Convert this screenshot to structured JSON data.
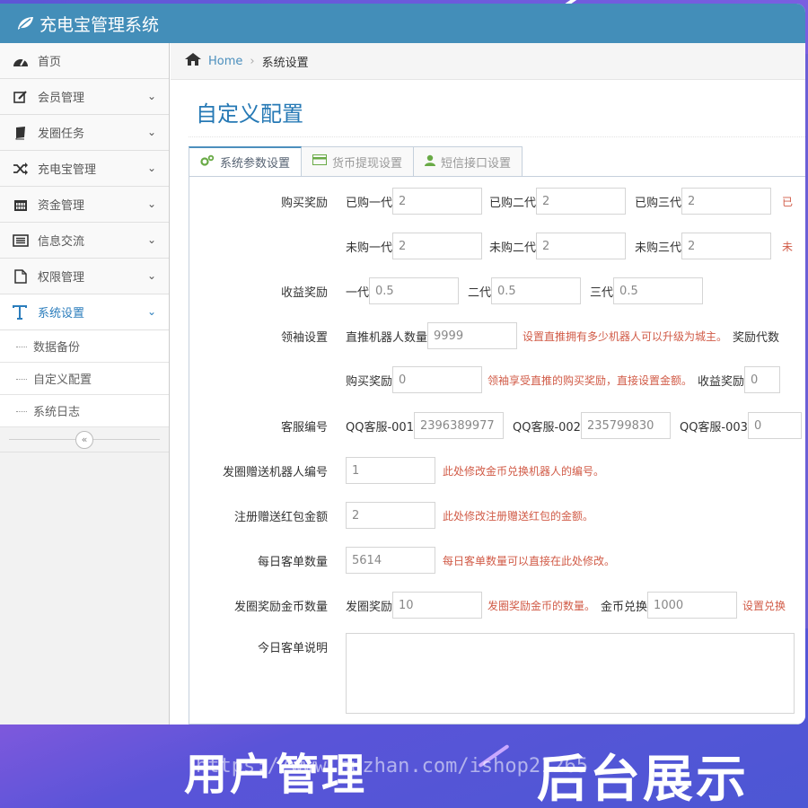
{
  "app": {
    "title": "充电宝管理系统"
  },
  "sidebar": {
    "items": [
      {
        "label": "首页",
        "icon": "dashboard-icon"
      },
      {
        "label": "会员管理",
        "icon": "edit-icon"
      },
      {
        "label": "发圈任务",
        "icon": "book-icon"
      },
      {
        "label": "充电宝管理",
        "icon": "shuffle-icon"
      },
      {
        "label": "资金管理",
        "icon": "calendar-icon"
      },
      {
        "label": "信息交流",
        "icon": "list-icon"
      },
      {
        "label": "权限管理",
        "icon": "file-icon"
      },
      {
        "label": "系统设置",
        "icon": "text-icon"
      }
    ],
    "sub_items": [
      {
        "label": "数据备份"
      },
      {
        "label": "自定义配置"
      },
      {
        "label": "系统日志"
      }
    ]
  },
  "breadcrumb": {
    "home": "Home",
    "current": "系统设置"
  },
  "page": {
    "title": "自定义配置"
  },
  "tabs": [
    {
      "label": "系统参数设置",
      "icon": "cogs-icon"
    },
    {
      "label": "货币提现设置",
      "icon": "credit-card-icon"
    },
    {
      "label": "短信接口设置",
      "icon": "user-icon"
    }
  ],
  "form": {
    "buy_reward": {
      "label": "购买奖励",
      "bought_gen1": {
        "label": "已购一代",
        "value": "2"
      },
      "bought_gen2": {
        "label": "已购二代",
        "value": "2"
      },
      "bought_gen3": {
        "label": "已购三代",
        "value": "2"
      },
      "bought_more": "已",
      "notbought_gen1": {
        "label": "未购一代",
        "value": "2"
      },
      "notbought_gen2": {
        "label": "未购二代",
        "value": "2"
      },
      "notbought_gen3": {
        "label": "未购三代",
        "value": "2"
      },
      "notbought_more": "未"
    },
    "income_reward": {
      "label": "收益奖励",
      "gen1": {
        "label": "一代",
        "value": "0.5"
      },
      "gen2": {
        "label": "二代",
        "value": "0.5"
      },
      "gen3": {
        "label": "三代",
        "value": "0.5"
      }
    },
    "leader": {
      "label": "领袖设置",
      "robot_count": {
        "label": "直推机器人数量",
        "value": "9999"
      },
      "robot_help": "设置直推拥有多少机器人可以升级为城主。",
      "reward_gen": "奖励代数",
      "buy_reward": {
        "label": "购买奖励",
        "value": "0"
      },
      "buy_help": "领袖享受直推的购买奖励，直接设置金额。",
      "income_reward": {
        "label": "收益奖励",
        "value": "0"
      }
    },
    "service": {
      "label": "客服编号",
      "qq1": {
        "label": "QQ客服-001",
        "value": "2396389977"
      },
      "qq2": {
        "label": "QQ客服-002",
        "value": "235799830"
      },
      "qq3": {
        "label": "QQ客服-003",
        "value": "0"
      }
    },
    "gift_robot": {
      "label": "发圈赠送机器人编号",
      "value": "1",
      "help": "此处修改金币兑换机器人的编号。"
    },
    "register_bonus": {
      "label": "注册赠送红包金额",
      "value": "2",
      "help": "此处修改注册赠送红包的金额。"
    },
    "daily_orders": {
      "label": "每日客单数量",
      "value": "5614",
      "help": "每日客单数量可以直接在此处修改。"
    },
    "coin_reward": {
      "label": "发圈奖励金币数量",
      "reward": {
        "label": "发圈奖励",
        "value": "10"
      },
      "reward_help": "发圈奖励金币的数量。",
      "exchange": {
        "label": "金币兑换",
        "value": "1000"
      },
      "exchange_help": "设置兑换"
    },
    "today_note": {
      "label": "今日客单说明",
      "value": ""
    }
  },
  "banner": {
    "left": "用户管理",
    "right": "后台展示",
    "url": "https://www.huzhan.com/ishop21265"
  },
  "colors": {
    "topbar": "#438eb9",
    "accent": "#2679b5",
    "help": "#d15b47"
  }
}
